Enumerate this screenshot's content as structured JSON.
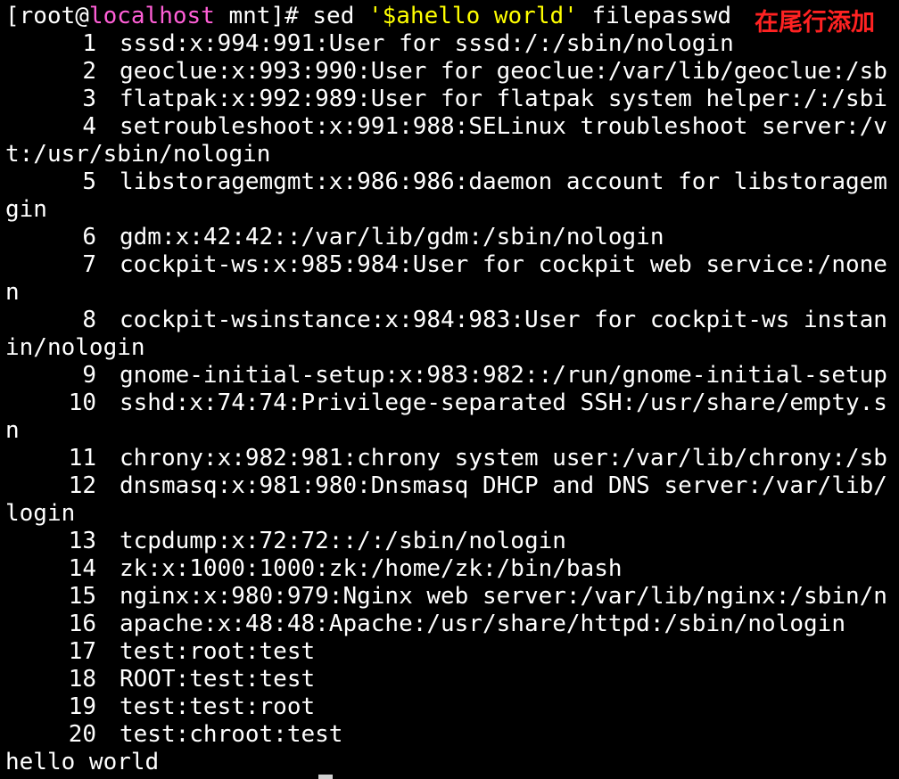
{
  "terminal": {
    "prompt": {
      "open": "[root@",
      "host": "localhost",
      "rest": " mnt]# sed ",
      "quoted": "'$ahello world'",
      "file": " filepasswd"
    },
    "annotation": "在尾行添加",
    "colors": {
      "background": "#000000",
      "text": "#ffffff",
      "host": "#ff5fd7",
      "quoted": "#ffff00",
      "annotation": "#ff2222"
    },
    "lines": [
      {
        "num": "1",
        "text": "sssd:x:994:991:User for sssd:/:/sbin/nologin"
      },
      {
        "num": "2",
        "text": "geoclue:x:993:990:User for geoclue:/var/lib/geoclue:/sb"
      },
      {
        "num": "3",
        "text": "flatpak:x:992:989:User for flatpak system helper:/:/sbi"
      },
      {
        "num": "4",
        "text": "setroubleshoot:x:991:988:SELinux troubleshoot server:/v"
      },
      {
        "num": "",
        "text": "t:/usr/sbin/nologin"
      },
      {
        "num": "5",
        "text": "libstoragemgmt:x:986:986:daemon account for libstoragem"
      },
      {
        "num": "",
        "text": "gin"
      },
      {
        "num": "6",
        "text": "gdm:x:42:42::/var/lib/gdm:/sbin/nologin"
      },
      {
        "num": "7",
        "text": "cockpit-ws:x:985:984:User for cockpit web service:/none"
      },
      {
        "num": "",
        "text": "n"
      },
      {
        "num": "8",
        "text": "cockpit-wsinstance:x:984:983:User for cockpit-ws instan"
      },
      {
        "num": "",
        "text": "in/nologin"
      },
      {
        "num": "9",
        "text": "gnome-initial-setup:x:983:982::/run/gnome-initial-setup"
      },
      {
        "num": "10",
        "text": "sshd:x:74:74:Privilege-separated SSH:/usr/share/empty.s"
      },
      {
        "num": "",
        "text": "n"
      },
      {
        "num": "11",
        "text": "chrony:x:982:981:chrony system user:/var/lib/chrony:/sb"
      },
      {
        "num": "12",
        "text": "dnsmasq:x:981:980:Dnsmasq DHCP and DNS server:/var/lib/"
      },
      {
        "num": "",
        "text": "login"
      },
      {
        "num": "13",
        "text": "tcpdump:x:72:72::/:/sbin/nologin"
      },
      {
        "num": "14",
        "text": "zk:x:1000:1000:zk:/home/zk:/bin/bash"
      },
      {
        "num": "15",
        "text": "nginx:x:980:979:Nginx web server:/var/lib/nginx:/sbin/n"
      },
      {
        "num": "16",
        "text": "apache:x:48:48:Apache:/usr/share/httpd:/sbin/nologin"
      },
      {
        "num": "17",
        "text": "test:root:test"
      },
      {
        "num": "18",
        "text": "ROOT:test:test"
      },
      {
        "num": "19",
        "text": "test:test:root"
      },
      {
        "num": "20",
        "text": "test:chroot:test"
      },
      {
        "num": "",
        "text": "hello world"
      }
    ]
  }
}
